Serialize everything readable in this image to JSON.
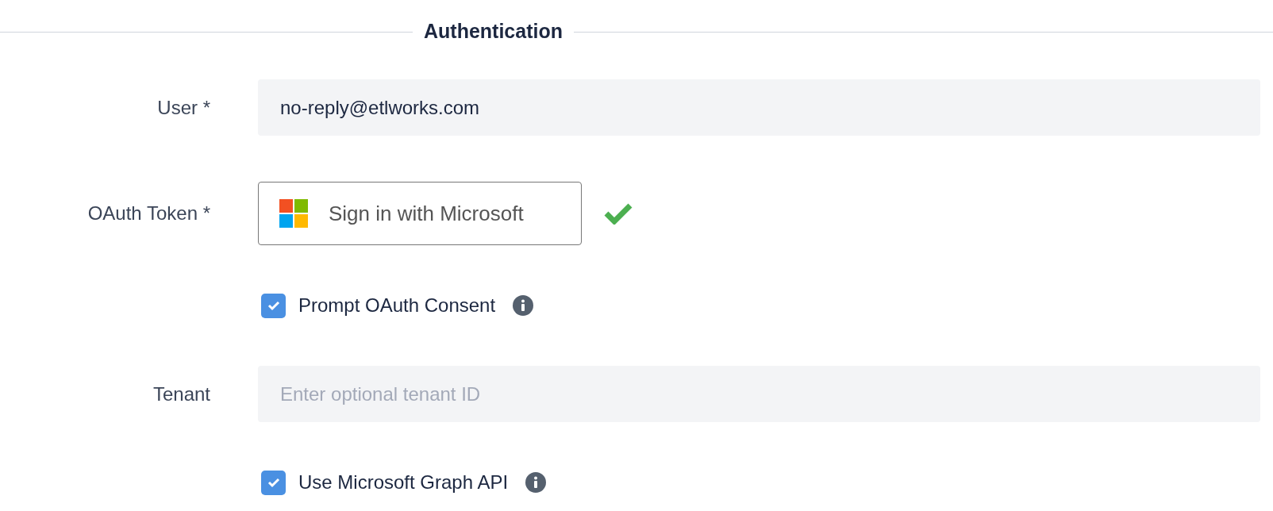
{
  "section": {
    "title": "Authentication"
  },
  "fields": [
    {
      "kind": "input",
      "label": "User *",
      "value": "no-reply@etlworks.com"
    },
    {
      "kind": "oauth",
      "label": "OAuth Token *",
      "button": "Sign in with Microsoft",
      "authorized": true
    },
    {
      "kind": "checkbox",
      "label": "Prompt OAuth Consent",
      "checked": true,
      "info": true
    },
    {
      "kind": "input",
      "label": "Tenant",
      "placeholder": "Enter optional tenant ID"
    },
    {
      "kind": "checkbox",
      "label": "Use Microsoft Graph API",
      "checked": true,
      "info": true
    }
  ]
}
